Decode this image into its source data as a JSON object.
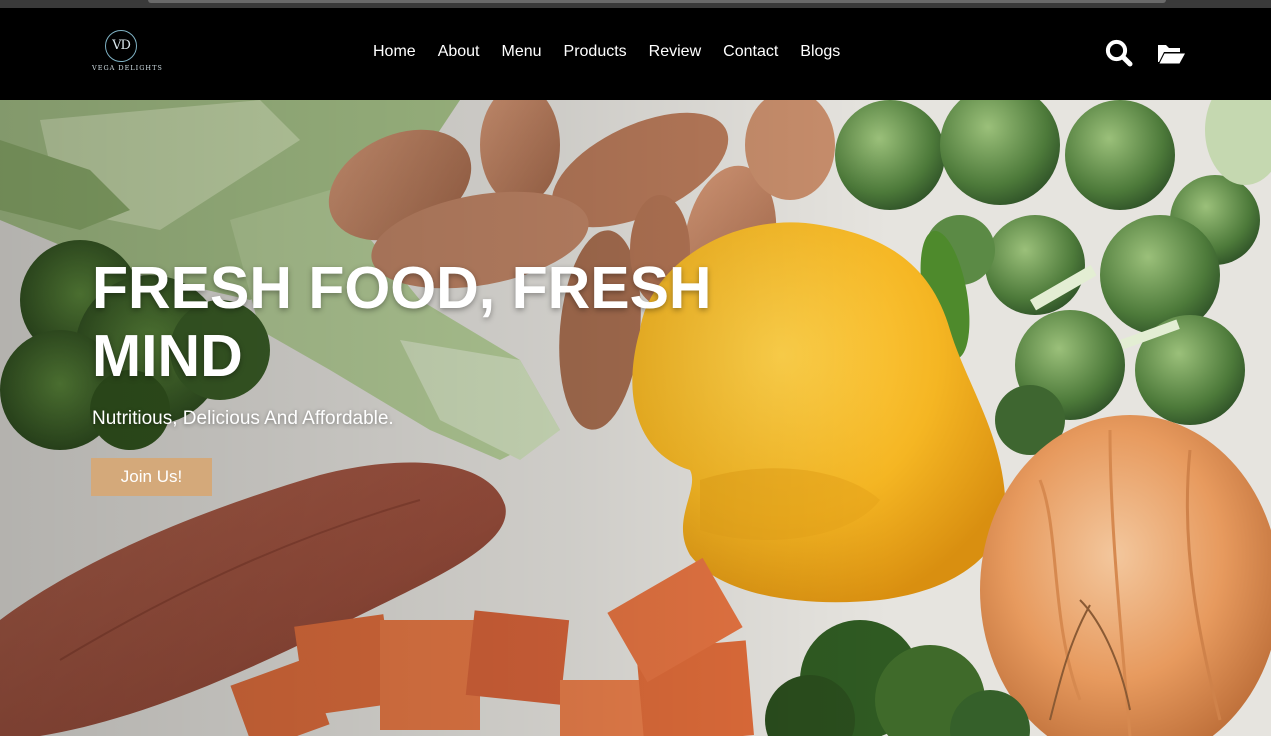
{
  "brand": {
    "monogram": "VD",
    "name": "VEGA DELIGHTS"
  },
  "nav": {
    "links": [
      "Home",
      "About",
      "Menu",
      "Products",
      "Review",
      "Contact",
      "Blogs"
    ],
    "icons": [
      "search-icon",
      "folder-open-icon"
    ]
  },
  "hero": {
    "title": "FRESH FOOD, FRESH MIND",
    "subtitle": "Nutritious, Delicious And Affordable.",
    "cta_label": "Join Us!"
  },
  "colors": {
    "navbar_bg": "#000000",
    "cta_bg": "#d4a97a",
    "text": "#ffffff",
    "logo_accent": "#7fb2c4"
  }
}
